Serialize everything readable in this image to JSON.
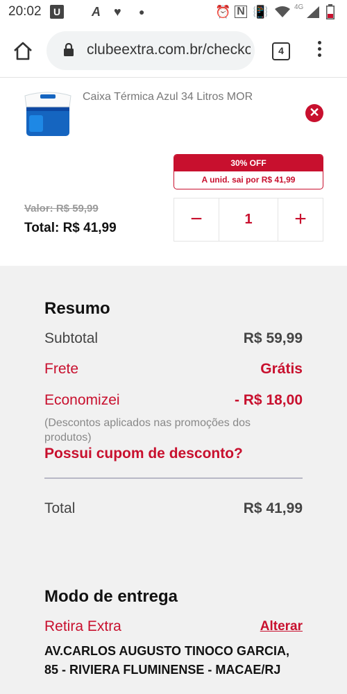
{
  "status_bar": {
    "time": "20:02",
    "u_badge": "U",
    "network_label": "4G",
    "icons": [
      "app-a-icon",
      "heart-icon",
      "dot-icon",
      "alarm-icon",
      "nfc-icon",
      "vibrate-icon",
      "wifi-icon",
      "signal-icon",
      "battery-icon"
    ]
  },
  "browser": {
    "url": "clubeextra.com.br/checkout",
    "tab_count": "4"
  },
  "product": {
    "name": "Caixa Térmica Azul 34 Litros MOR",
    "remove_symbol": "✕",
    "promo_badge": "30% OFF",
    "unit_price_prefix": "A unid. sai por ",
    "unit_price_value": "R$ 41,99",
    "old_value": "Valor: R$ 59,99",
    "total": "Total: R$ 41,99",
    "quantity": "1",
    "minus_symbol": "−",
    "plus_symbol": "+"
  },
  "summary": {
    "title": "Resumo",
    "subtotal_label": "Subtotal",
    "subtotal_value": "R$ 59,99",
    "frete_label": "Frete",
    "frete_value": "Grátis",
    "economizei_label": "Economizei",
    "economizei_value": "- R$ 18,00",
    "discount_note": "(Descontos aplicados nas promoções dos produtos)",
    "coupon_link": "Possui cupom de desconto?",
    "total_label": "Total",
    "total_value": "R$ 41,99"
  },
  "delivery": {
    "title": "Modo de entrega",
    "mode": "Retira Extra",
    "change_link": "Alterar",
    "address": "AV.CARLOS AUGUSTO TINOCO GARCIA, 85 - RIVIERA FLUMINENSE - MACAE/RJ"
  },
  "colors": {
    "accent_red": "#c8102e",
    "summary_bg": "#f1f1f1",
    "cooler_blue": "#1565c0"
  }
}
